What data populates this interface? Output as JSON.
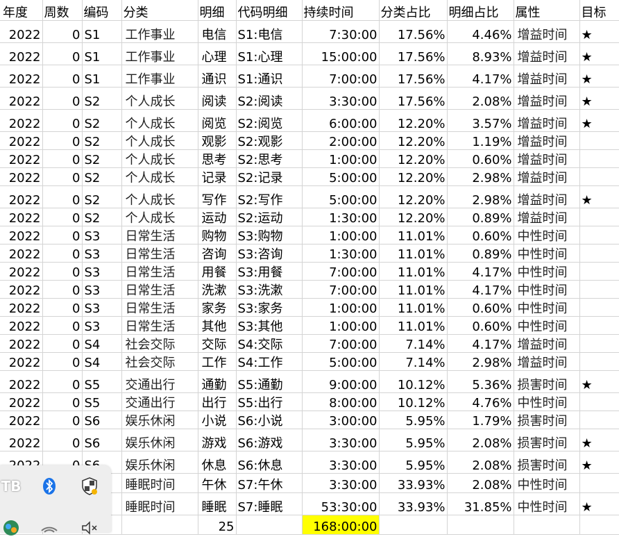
{
  "headers": [
    "年度",
    "周数",
    "编码",
    "分类",
    "明细",
    "代码明细",
    "持续时间",
    "分类占比",
    "明细占比",
    "属性",
    "目标"
  ],
  "rows": [
    [
      "2022",
      "0",
      "S1",
      "工作事业",
      "电信",
      "S1:电信",
      "7:30:00",
      "17.56%",
      "4.46%",
      "增益时间",
      "★"
    ],
    [
      "2022",
      "0",
      "S1",
      "工作事业",
      "心理",
      "S1:心理",
      "15:00:00",
      "17.56%",
      "8.93%",
      "增益时间",
      "★"
    ],
    [
      "2022",
      "0",
      "S1",
      "工作事业",
      "通识",
      "S1:通识",
      "7:00:00",
      "17.56%",
      "4.17%",
      "增益时间",
      "★"
    ],
    [
      "2022",
      "0",
      "S2",
      "个人成长",
      "阅读",
      "S2:阅读",
      "3:30:00",
      "17.56%",
      "2.08%",
      "增益时间",
      "★"
    ],
    [
      "2022",
      "0",
      "S2",
      "个人成长",
      "阅览",
      "S2:阅览",
      "6:00:00",
      "12.20%",
      "3.57%",
      "增益时间",
      "★"
    ],
    [
      "2022",
      "0",
      "S2",
      "个人成长",
      "观影",
      "S2:观影",
      "2:00:00",
      "12.20%",
      "1.19%",
      "增益时间",
      ""
    ],
    [
      "2022",
      "0",
      "S2",
      "个人成长",
      "思考",
      "S2:思考",
      "1:00:00",
      "12.20%",
      "0.60%",
      "增益时间",
      ""
    ],
    [
      "2022",
      "0",
      "S2",
      "个人成长",
      "记录",
      "S2:记录",
      "5:00:00",
      "12.20%",
      "2.98%",
      "增益时间",
      ""
    ],
    [
      "2022",
      "0",
      "S2",
      "个人成长",
      "写作",
      "S2:写作",
      "5:00:00",
      "12.20%",
      "2.98%",
      "增益时间",
      "★"
    ],
    [
      "2022",
      "0",
      "S2",
      "个人成长",
      "运动",
      "S2:运动",
      "1:30:00",
      "12.20%",
      "0.89%",
      "增益时间",
      ""
    ],
    [
      "2022",
      "0",
      "S3",
      "日常生活",
      "购物",
      "S3:购物",
      "1:00:00",
      "11.01%",
      "0.60%",
      "中性时间",
      ""
    ],
    [
      "2022",
      "0",
      "S3",
      "日常生活",
      "咨询",
      "S3:咨询",
      "1:30:00",
      "11.01%",
      "0.89%",
      "中性时间",
      ""
    ],
    [
      "2022",
      "0",
      "S3",
      "日常生活",
      "用餐",
      "S3:用餐",
      "7:00:00",
      "11.01%",
      "4.17%",
      "中性时间",
      ""
    ],
    [
      "2022",
      "0",
      "S3",
      "日常生活",
      "洗漱",
      "S3:洗漱",
      "7:00:00",
      "11.01%",
      "4.17%",
      "中性时间",
      ""
    ],
    [
      "2022",
      "0",
      "S3",
      "日常生活",
      "家务",
      "S3:家务",
      "1:00:00",
      "11.01%",
      "0.60%",
      "中性时间",
      ""
    ],
    [
      "2022",
      "0",
      "S3",
      "日常生活",
      "其他",
      "S3:其他",
      "1:00:00",
      "11.01%",
      "0.60%",
      "中性时间",
      ""
    ],
    [
      "2022",
      "0",
      "S4",
      "社会交际",
      "交际",
      "S4:交际",
      "7:00:00",
      "7.14%",
      "4.17%",
      "增益时间",
      ""
    ],
    [
      "2022",
      "0",
      "S4",
      "社会交际",
      "工作",
      "S4:工作",
      "5:00:00",
      "7.14%",
      "2.98%",
      "增益时间",
      ""
    ],
    [
      "2022",
      "0",
      "S5",
      "交通出行",
      "通勤",
      "S5:通勤",
      "9:00:00",
      "10.12%",
      "5.36%",
      "损害时间",
      "★"
    ],
    [
      "2022",
      "0",
      "S5",
      "交通出行",
      "出行",
      "S5:出行",
      "8:00:00",
      "10.12%",
      "4.76%",
      "中性时间",
      ""
    ],
    [
      "2022",
      "0",
      "S6",
      "娱乐休闲",
      "小说",
      "S6:小说",
      "3:00:00",
      "5.95%",
      "1.79%",
      "损害时间",
      ""
    ],
    [
      "2022",
      "0",
      "S6",
      "娱乐休闲",
      "游戏",
      "S6:游戏",
      "3:30:00",
      "5.95%",
      "2.08%",
      "损害时间",
      "★"
    ],
    [
      "2022",
      "0",
      "S6",
      "娱乐休闲",
      "休息",
      "S6:休息",
      "3:30:00",
      "5.95%",
      "2.08%",
      "损害时间",
      "★"
    ],
    [
      "",
      "",
      "",
      "睡眠时间",
      "午休",
      "S7:午休",
      "3:30:00",
      "33.93%",
      "2.08%",
      "中性时间",
      ""
    ],
    [
      "",
      "",
      "",
      "睡眠时间",
      "睡眠",
      "S7:睡眠",
      "53:30:00",
      "33.93%",
      "31.85%",
      "中性时间",
      "★"
    ]
  ],
  "totals": {
    "count": "25",
    "duration": "168:00:00"
  },
  "tray": {
    "icons": [
      "app-tb-icon",
      "bluetooth-icon",
      "security-shield-icon",
      "network-globe-icon",
      "wifi-icon",
      "volume-muted-icon"
    ],
    "tb_label": "TB"
  }
}
